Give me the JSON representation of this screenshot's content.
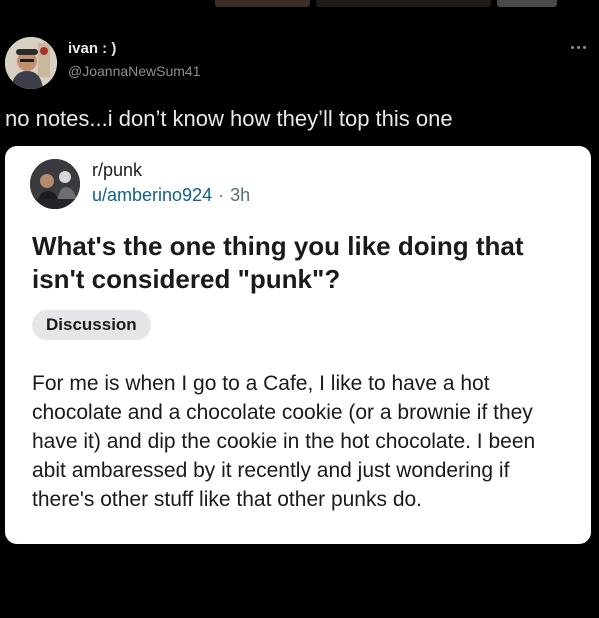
{
  "tweet": {
    "display_name": "ivan : )",
    "handle": "@JoannaNewSum41",
    "text": "no notes...i don’t know how they’ll top this one",
    "more_icon": "more-horizontal-icon"
  },
  "reddit_post": {
    "subreddit": "r/punk",
    "username": "u/amberino924",
    "separator": "·",
    "age": "3h",
    "title": "What's the one thing you like doing that isn't considered \"punk\"?",
    "flair": "Discussion",
    "body": "For me is when I go to a Cafe, I like to have a hot chocolate and a chocolate cookie (or a brownie if they have it) and dip the cookie in the hot chocolate. I been abit ambaressed by it recently and just wondering if there's other stuff like that other punks do."
  },
  "colors": {
    "background": "#000000",
    "tweet_text": "#e7e9ea",
    "muted_text": "#8b9096",
    "card_background": "#ffffff",
    "username_link": "#0f5f8a",
    "flair_background": "#e5e6e7"
  }
}
